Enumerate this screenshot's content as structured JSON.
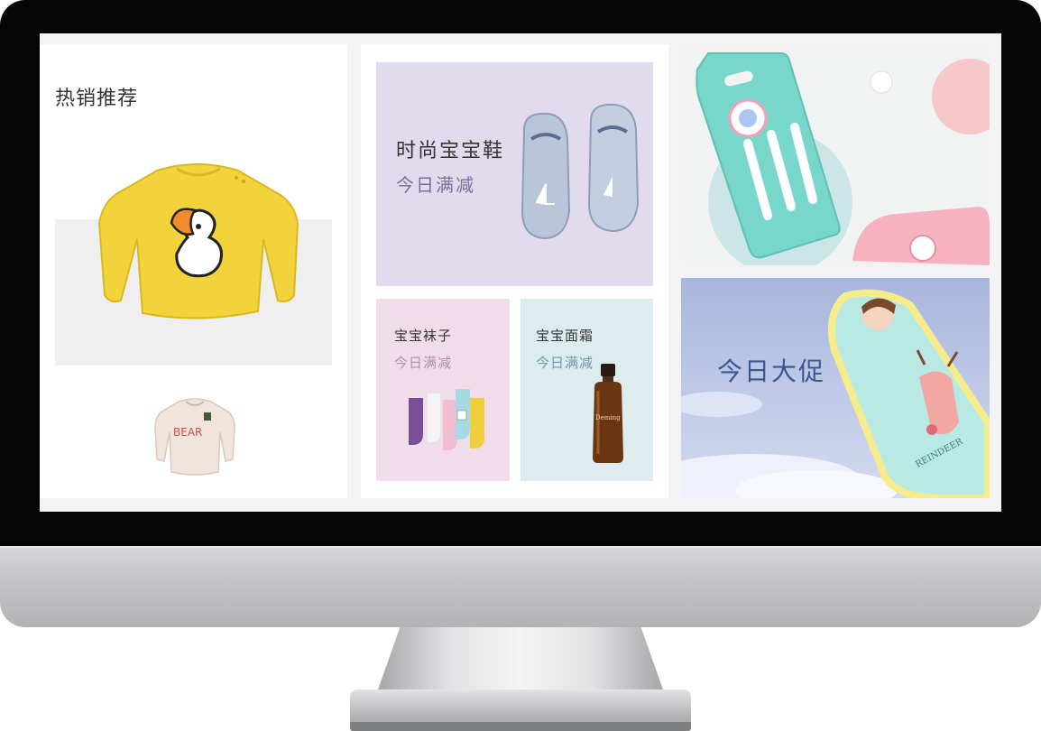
{
  "hot": {
    "title": "热销推荐"
  },
  "shoes": {
    "title": "时尚宝宝鞋",
    "subtitle": "今日满减"
  },
  "socks": {
    "title": "宝宝袜子",
    "subtitle": "今日满减"
  },
  "cream": {
    "title": "宝宝面霜",
    "subtitle": "今日满减"
  },
  "promo": {
    "title": "今日大促"
  },
  "product_text": {
    "beige_shirt": "BEAR",
    "bottle": "Deming",
    "sleeping_bag": "REINDEER"
  },
  "colors": {
    "shoes_card": "#e2dbee",
    "socks_card": "#f1dde9",
    "cream_card": "#dcecef",
    "promo_title": "#3c5690"
  }
}
